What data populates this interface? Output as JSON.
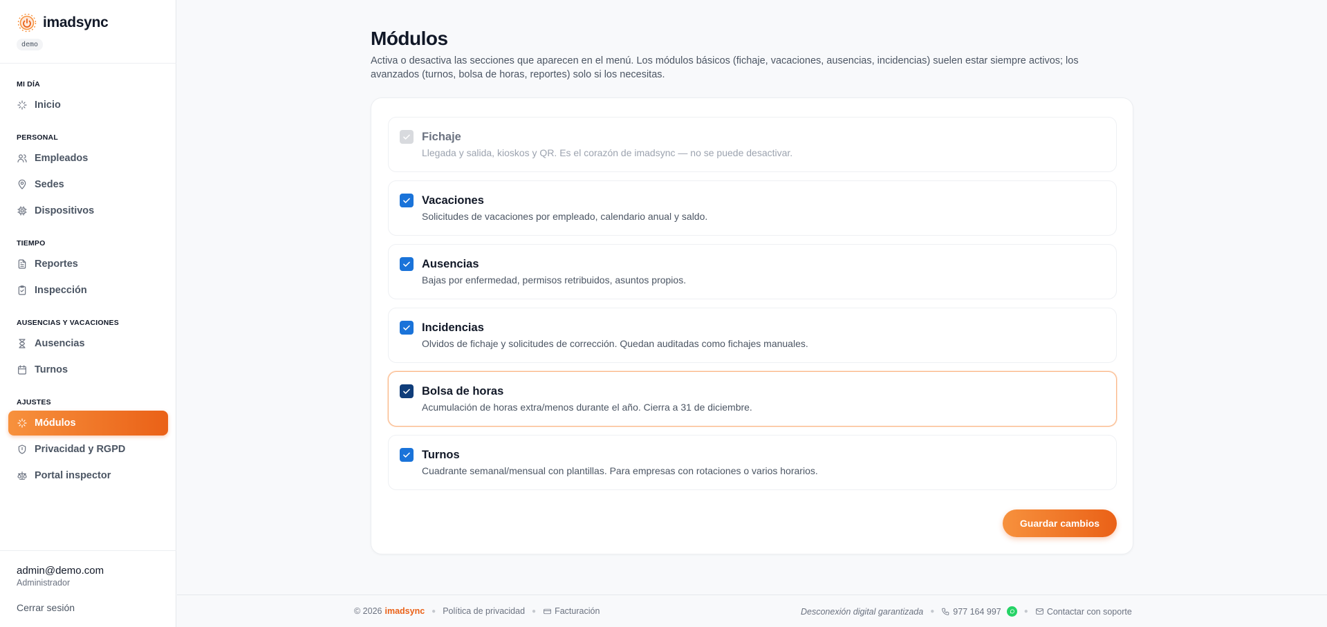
{
  "app": {
    "name": "imadsync",
    "env_badge": "demo"
  },
  "sidebar": {
    "sections": [
      {
        "title": "MI DÍA",
        "items": [
          {
            "label": "Inicio",
            "icon": "sparkle-icon"
          }
        ]
      },
      {
        "title": "PERSONAL",
        "items": [
          {
            "label": "Empleados",
            "icon": "users-icon"
          },
          {
            "label": "Sedes",
            "icon": "map-pin-icon"
          },
          {
            "label": "Dispositivos",
            "icon": "cpu-icon"
          }
        ]
      },
      {
        "title": "TIEMPO",
        "items": [
          {
            "label": "Reportes",
            "icon": "file-text-icon"
          },
          {
            "label": "Inspección",
            "icon": "clipboard-check-icon"
          }
        ]
      },
      {
        "title": "AUSENCIAS Y VACACIONES",
        "items": [
          {
            "label": "Ausencias",
            "icon": "hourglass-icon"
          },
          {
            "label": "Turnos",
            "icon": "calendar-icon"
          }
        ]
      },
      {
        "title": "AJUSTES",
        "items": [
          {
            "label": "Módulos",
            "icon": "sparkle-icon",
            "active": true
          },
          {
            "label": "Privacidad y RGPD",
            "icon": "shield-icon"
          },
          {
            "label": "Portal inspector",
            "icon": "scale-icon"
          }
        ]
      }
    ],
    "user": {
      "email": "admin@demo.com",
      "role": "Administrador",
      "logout_label": "Cerrar sesión"
    }
  },
  "main": {
    "title": "Módulos",
    "description": "Activa o desactiva las secciones que aparecen en el menú. Los módulos básicos (fichaje, vacaciones, ausencias, incidencias) suelen estar siempre activos; los avanzados (turnos, bolsa de horas, reportes) solo si los necesitas.",
    "modules": [
      {
        "title": "Fichaje",
        "description": "Llegada y salida, kioskos y QR. Es el corazón de imadsync — no se puede desactivar.",
        "checked": true,
        "disabled": true
      },
      {
        "title": "Vacaciones",
        "description": "Solicitudes de vacaciones por empleado, calendario anual y saldo.",
        "checked": true
      },
      {
        "title": "Ausencias",
        "description": "Bajas por enfermedad, permisos retribuidos, asuntos propios.",
        "checked": true
      },
      {
        "title": "Incidencias",
        "description": "Olvidos de fichaje y solicitudes de corrección. Quedan auditadas como fichajes manuales.",
        "checked": true
      },
      {
        "title": "Bolsa de horas",
        "description": "Acumulación de horas extra/menos durante el año. Cierra a 31 de diciembre.",
        "checked": true,
        "focused": true
      },
      {
        "title": "Turnos",
        "description": "Cuadrante semanal/mensual con plantillas. Para empresas con rotaciones o varios horarios.",
        "checked": true
      }
    ],
    "save_label": "Guardar cambios"
  },
  "footer": {
    "copyright": "© 2026",
    "brand": "imadsync",
    "privacy_label": "Política de privacidad",
    "billing_label": "Facturación",
    "tagline": "Desconexión digital garantizada",
    "phone": "977 164 997",
    "support_label": "Contactar con soporte"
  },
  "colors": {
    "accent": "#ea6117",
    "accent_light": "#f7913d",
    "checkbox": "#1a73d9"
  }
}
